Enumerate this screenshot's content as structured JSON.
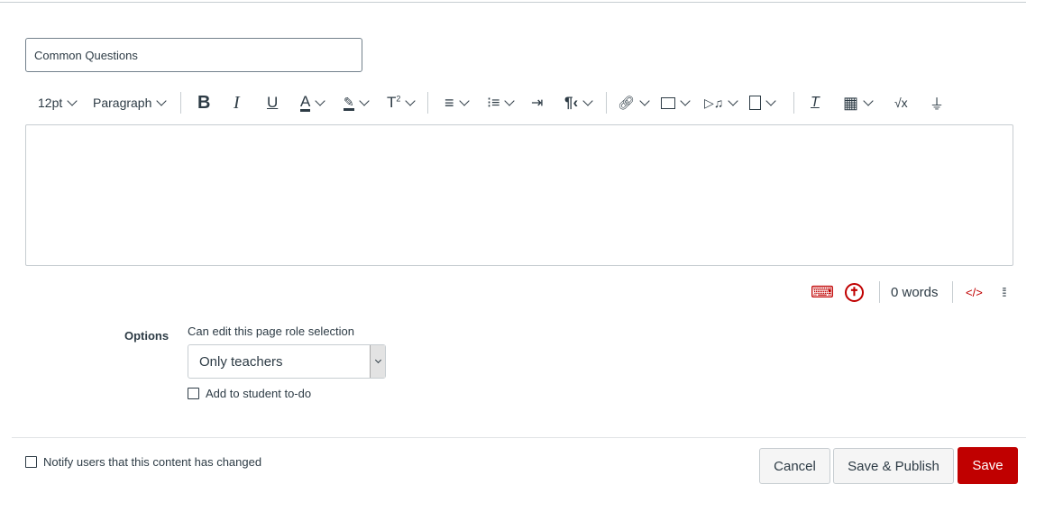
{
  "title_field": {
    "value": "Common Questions"
  },
  "toolbar": {
    "font_size": "12pt",
    "block_format": "Paragraph",
    "icons": [
      "bold-icon",
      "italic-icon",
      "underline-icon",
      "text-color-icon",
      "highlight-icon",
      "superscript-icon",
      "align-icon",
      "list-icon",
      "indent-icon",
      "text-direction-icon",
      "link-icon",
      "image-icon",
      "media-icon",
      "document-icon",
      "clear-formatting-icon",
      "table-icon",
      "equation-icon",
      "plugin-icon"
    ]
  },
  "status_bar": {
    "word_count": "0 words",
    "accent": "#c00000"
  },
  "options": {
    "label": "Options",
    "role_label": "Can edit this page role selection",
    "role_selected": "Only teachers",
    "todo_label": "Add to student to-do"
  },
  "footer": {
    "notify_label": "Notify users that this content has changed",
    "cancel": "Cancel",
    "save_publish": "Save & Publish",
    "save": "Save",
    "save_color": "#c00000"
  }
}
